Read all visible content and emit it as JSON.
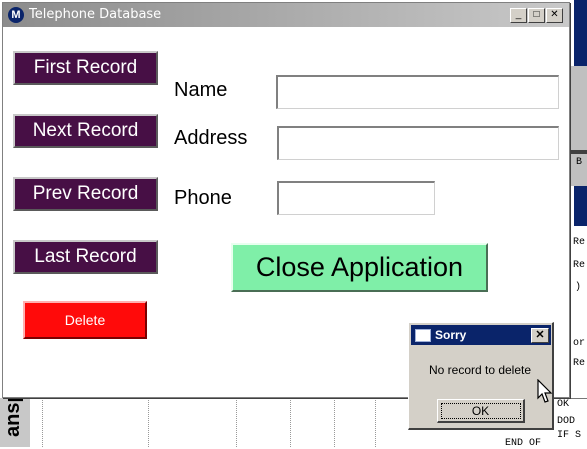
{
  "window": {
    "title": "Telephone Database",
    "minimize_glyph": "_",
    "maximize_glyph": "□",
    "close_glyph": "✕"
  },
  "navigation": {
    "first": "First Record",
    "next": "Next Record",
    "prev": "Prev Record",
    "last": "Last Record"
  },
  "form": {
    "name_label": "Name",
    "address_label": "Address",
    "phone_label": "Phone",
    "name_value": "",
    "address_value": "",
    "phone_value": ""
  },
  "actions": {
    "close_app": "Close Application",
    "delete": "Delete"
  },
  "dialog": {
    "title": "Sorry",
    "message": "No record to delete",
    "ok": "OK",
    "close_glyph": "✕"
  },
  "background": {
    "side_label": "ansp",
    "right_lines": [
      "B",
      "Re",
      "Re",
      ")",
      "or",
      "Re"
    ],
    "bottom_lines": [
      "OK",
      "DOD",
      "IF S",
      "END OF"
    ]
  },
  "colors": {
    "nav_button": "#470f45",
    "close_button": "#7fefa8",
    "delete_button": "#ff0a0a",
    "dialog_title": "#0a246a"
  }
}
